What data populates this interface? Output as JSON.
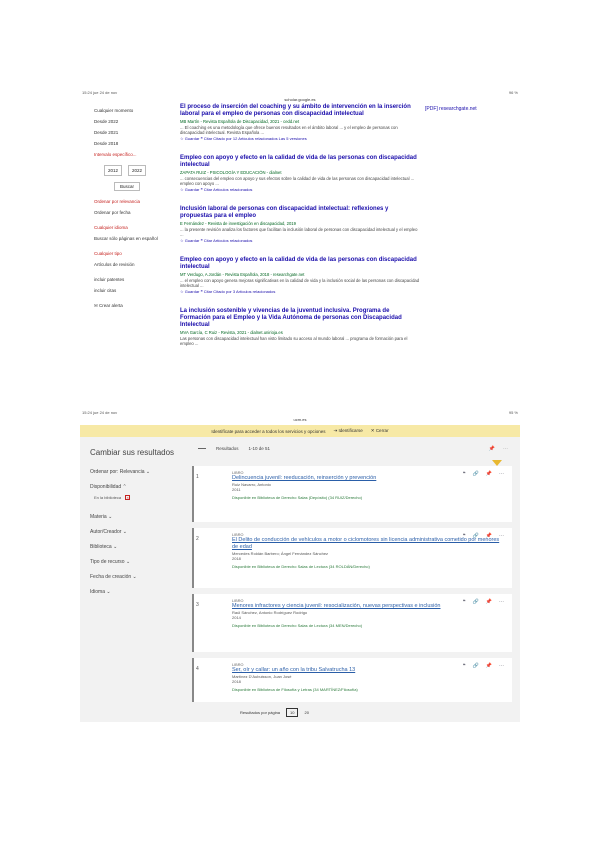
{
  "shot1": {
    "status_left": "15:24 jue 24 de nov",
    "status_right": "96 %",
    "url": "scholar.google.es",
    "filters": [
      {
        "label": "Cualquier momento"
      },
      {
        "label": "Desde 2022"
      },
      {
        "label": "Desde 2021"
      },
      {
        "label": "Desde 2018"
      },
      {
        "label": "Intervalo específico..."
      }
    ],
    "range_from": "2012",
    "range_to": "2022",
    "search_label": "Buscar",
    "order": [
      {
        "label": "Ordenar por relevancia"
      },
      {
        "label": "Ordenar por fecha"
      }
    ],
    "types": [
      {
        "label": "Cualquier idioma"
      },
      {
        "label": "Buscar sólo páginas en español"
      }
    ],
    "types2": [
      {
        "label": "Cualquier tipo"
      },
      {
        "label": "Artículos de revisión"
      }
    ],
    "extras": [
      {
        "label": "incluir patentes"
      },
      {
        "label": "incluir citas"
      }
    ],
    "alert_label": "Crear alerta",
    "side_link": "[PDF] researchgate.net",
    "results": [
      {
        "title": "El proceso de inserción del coaching y su ámbito de intervención en la inserción laboral para el empleo de personas con discapacidad intelectual",
        "authors": "MB Martín - Revista Española de Discapacidad, 2021 - cedd.net",
        "desc": "... El coaching es una metodología que ofrece buenos resultados en el ámbito laboral ... y el empleo de personas con discapacidad intelectual. Revista Española ...",
        "cite": "☆ Guardar  ❝ Citar  Citado por 12  Artículos relacionados  Las 5 versiones"
      },
      {
        "title": "Empleo con apoyo y efecto en la calidad de vida de las personas con discapacidad intelectual",
        "authors": "ZAPATA RUIZ - PSICOLOGÍA Y EDUCACIÓN - dialnet",
        "desc": "... consecuencias del empleo con apoyo y sus efectos sobre la calidad de vida de las personas con discapacidad intelectual ... empleo con apoyo ...",
        "cite": "☆ Guardar  ❝ Citar  Artículos relacionados"
      },
      {
        "title": "Inclusión laboral de personas con discapacidad intelectual: reflexiones y propuestas para el empleo",
        "authors": "E Fernández - Revista de investigación en discapacidad, 2019",
        "desc": "... la presente revisión analiza los factores que facilitan la inclusión laboral de personas con discapacidad intelectual y el empleo ...",
        "cite": "☆ Guardar  ❝ Citar  Artículos relacionados"
      },
      {
        "title": "Empleo con apoyo y efecto en la calidad de vida de las personas con discapacidad intelectual",
        "authors": "MT Verdugo, A Jordán - Revista Española, 2018 - researchgate.net",
        "desc": "... el empleo con apoyo genera mejoras significativas en la calidad de vida y la inclusión social de las personas con discapacidad intelectual ...",
        "cite": "☆ Guardar  ❝ Citar  Citado por 3  Artículos relacionados"
      },
      {
        "title": "La inclusión sostenible y vivencias de la juventud inclusiva. Programa de Formación para el Empleo y la Vida Autónoma de personas con Discapacidad Intelectual",
        "authors": "MVA García, C Ruiz - Revista, 2021 - dialnet.unirioja.es",
        "desc": "Las personas con discapacidad intelectual han visto limitado su acceso al mundo laboral ... programa de formación para el empleo ...",
        "cite": ""
      }
    ]
  },
  "shot2": {
    "status_left": "15:24 jue 24 de nov",
    "status_right": "95 %",
    "url": "ucm.es",
    "banner_text": "Identifícate para acceder a todos los servicios y opciones",
    "banner_login": "Identificarse",
    "banner_close": "Cerrar",
    "sidebar_title": "Cambiar sus resultados",
    "order_label": "Ordenar por: Relevancia",
    "availability_label": "Disponibilidad",
    "availability_chip": "En la biblioteca",
    "filters": [
      {
        "label": "Materia"
      },
      {
        "label": "Autor/Creador"
      },
      {
        "label": "Biblioteca"
      },
      {
        "label": "Tipo de recurso"
      },
      {
        "label": "Fecha de creación"
      },
      {
        "label": "Idioma"
      }
    ],
    "top_results": "Resultados",
    "top_page": "1-10 de 51",
    "records": [
      {
        "num": "1",
        "type": "LIBRO",
        "title": "Delincuencia juvenil: reeducación, reinserción y prevención",
        "authors": "Ruiz Navarro, Antonio",
        "year": "2011",
        "avail": "Disponible en Biblioteca de Derecho Salas (Depósito) (34 RUIZ/Derecho)"
      },
      {
        "num": "2",
        "type": "LIBRO",
        "title": "El Delito de conducción de vehículos a motor o ciclomotores sin licencia administrativa cometido por menores de edad",
        "authors": "Mercedes Roldán Barbero; Ángel Fernández Sánchez",
        "year": "2018",
        "avail": "Disponible en Biblioteca de Derecho Salas de Lectura (34 ROLDÁN/Derecho)"
      },
      {
        "num": "3",
        "type": "LIBRO",
        "title": "Menores infractores y ciencia juvenil: resocialización, nuevas perspectivas e inclusión",
        "authors": "Raúl Sánchez, Antonio Rodríguez Rodrigo",
        "year": "2014",
        "avail": "Disponible en Biblioteca de Derecho Salas de Lectura (34 MEN/Derecho)"
      },
      {
        "num": "4",
        "type": "LIBRO",
        "title": "Ser, oír y callar: un año con la tribu Salvatrucha 13",
        "authors": "Martínez D'Aubuisson, Juan José",
        "year": "2018",
        "avail": "Disponible en Biblioteca de Filosofía y Letras (34 MARTÍNEZ/Filosofía)"
      }
    ],
    "pager_label": "Resultados por página",
    "pager_current": "10",
    "pager_next": "20"
  }
}
